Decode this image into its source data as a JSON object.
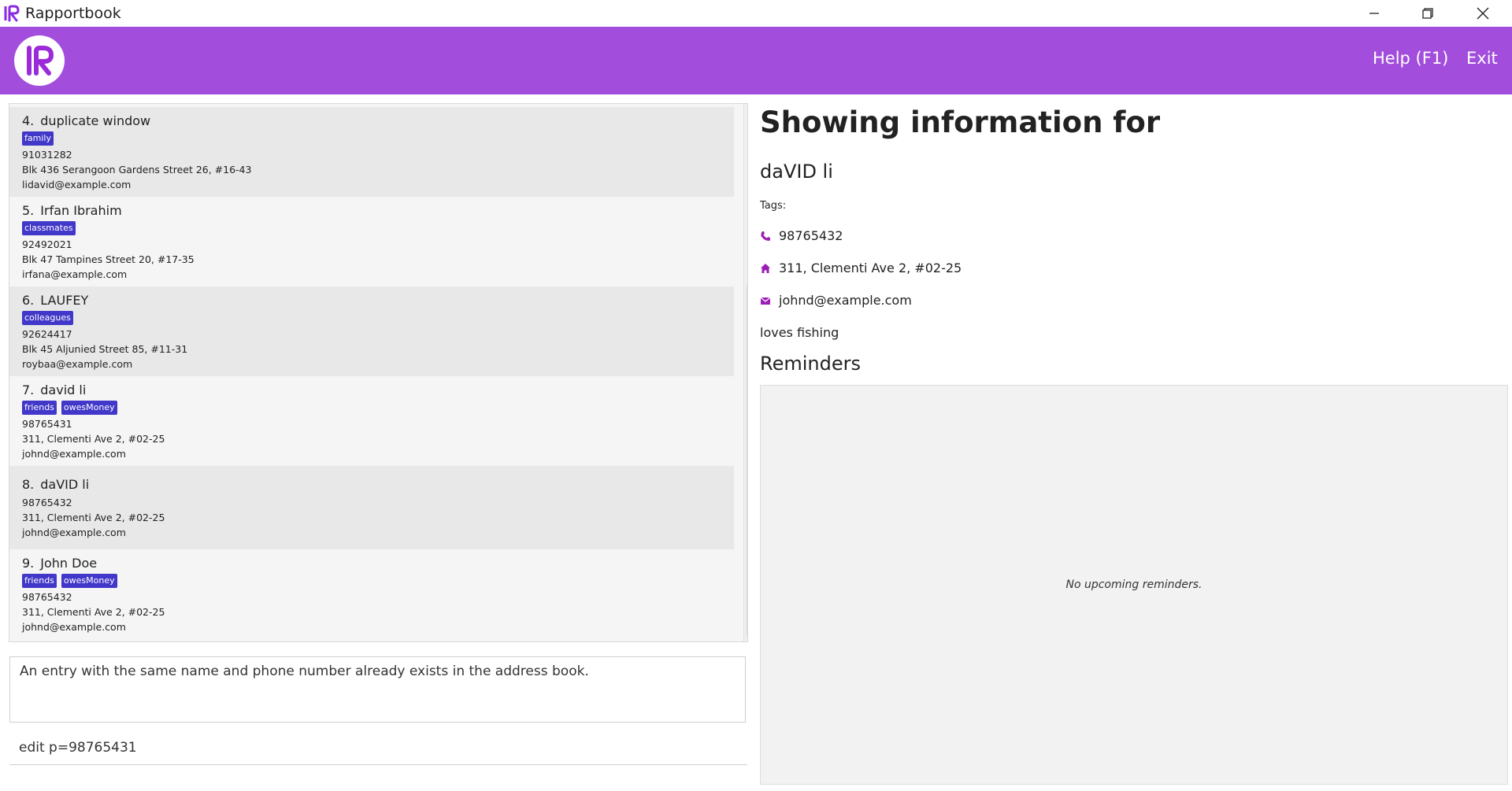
{
  "window": {
    "title": "Rapportbook",
    "icons": {
      "minimize": "minimize-icon",
      "maximize": "restore-icon",
      "close": "close-icon"
    }
  },
  "header": {
    "brand_color": "#a24ddc",
    "menu": {
      "help": "Help (F1)",
      "exit": "Exit"
    }
  },
  "contacts": [
    {
      "index": "4.",
      "name": "duplicate window",
      "tags": [
        "family"
      ],
      "phone": "91031282",
      "address": "Blk 436 Serangoon Gardens Street 26, #16-43",
      "email": "lidavid@example.com"
    },
    {
      "index": "5.",
      "name": "Irfan Ibrahim",
      "tags": [
        "classmates"
      ],
      "phone": "92492021",
      "address": "Blk 47 Tampines Street 20, #17-35",
      "email": "irfana@example.com"
    },
    {
      "index": "6.",
      "name": "LAUFEY",
      "tags": [
        "colleagues"
      ],
      "phone": "92624417",
      "address": "Blk 45 Aljunied Street 85, #11-31",
      "email": "roybaa@example.com"
    },
    {
      "index": "7.",
      "name": "david li",
      "tags": [
        "friends",
        "owesMoney"
      ],
      "phone": "98765431",
      "address": "311, Clementi Ave 2, #02-25",
      "email": "johnd@example.com"
    },
    {
      "index": "8.",
      "name": "daVID li",
      "tags": [],
      "phone": "98765432",
      "address": "311, Clementi Ave 2, #02-25",
      "email": "johnd@example.com"
    },
    {
      "index": "9.",
      "name": "John Doe",
      "tags": [
        "friends",
        "owesMoney"
      ],
      "phone": "98765432",
      "address": "311, Clementi Ave 2, #02-25",
      "email": "johnd@example.com"
    }
  ],
  "tag_color": "#4137c9",
  "result": {
    "message": "An entry with the same name and phone number already exists in the address book."
  },
  "command": {
    "value": "edit p=98765431"
  },
  "detail": {
    "heading": "Showing information for",
    "name": "daVID li",
    "tags_label": "Tags:",
    "phone": "98765432",
    "address": "311, Clementi Ave 2, #02-25",
    "email": "johnd@example.com",
    "remark": "loves fishing",
    "icon_color": "#9b1fb5"
  },
  "reminders": {
    "title": "Reminders",
    "empty_text": "No upcoming reminders."
  }
}
